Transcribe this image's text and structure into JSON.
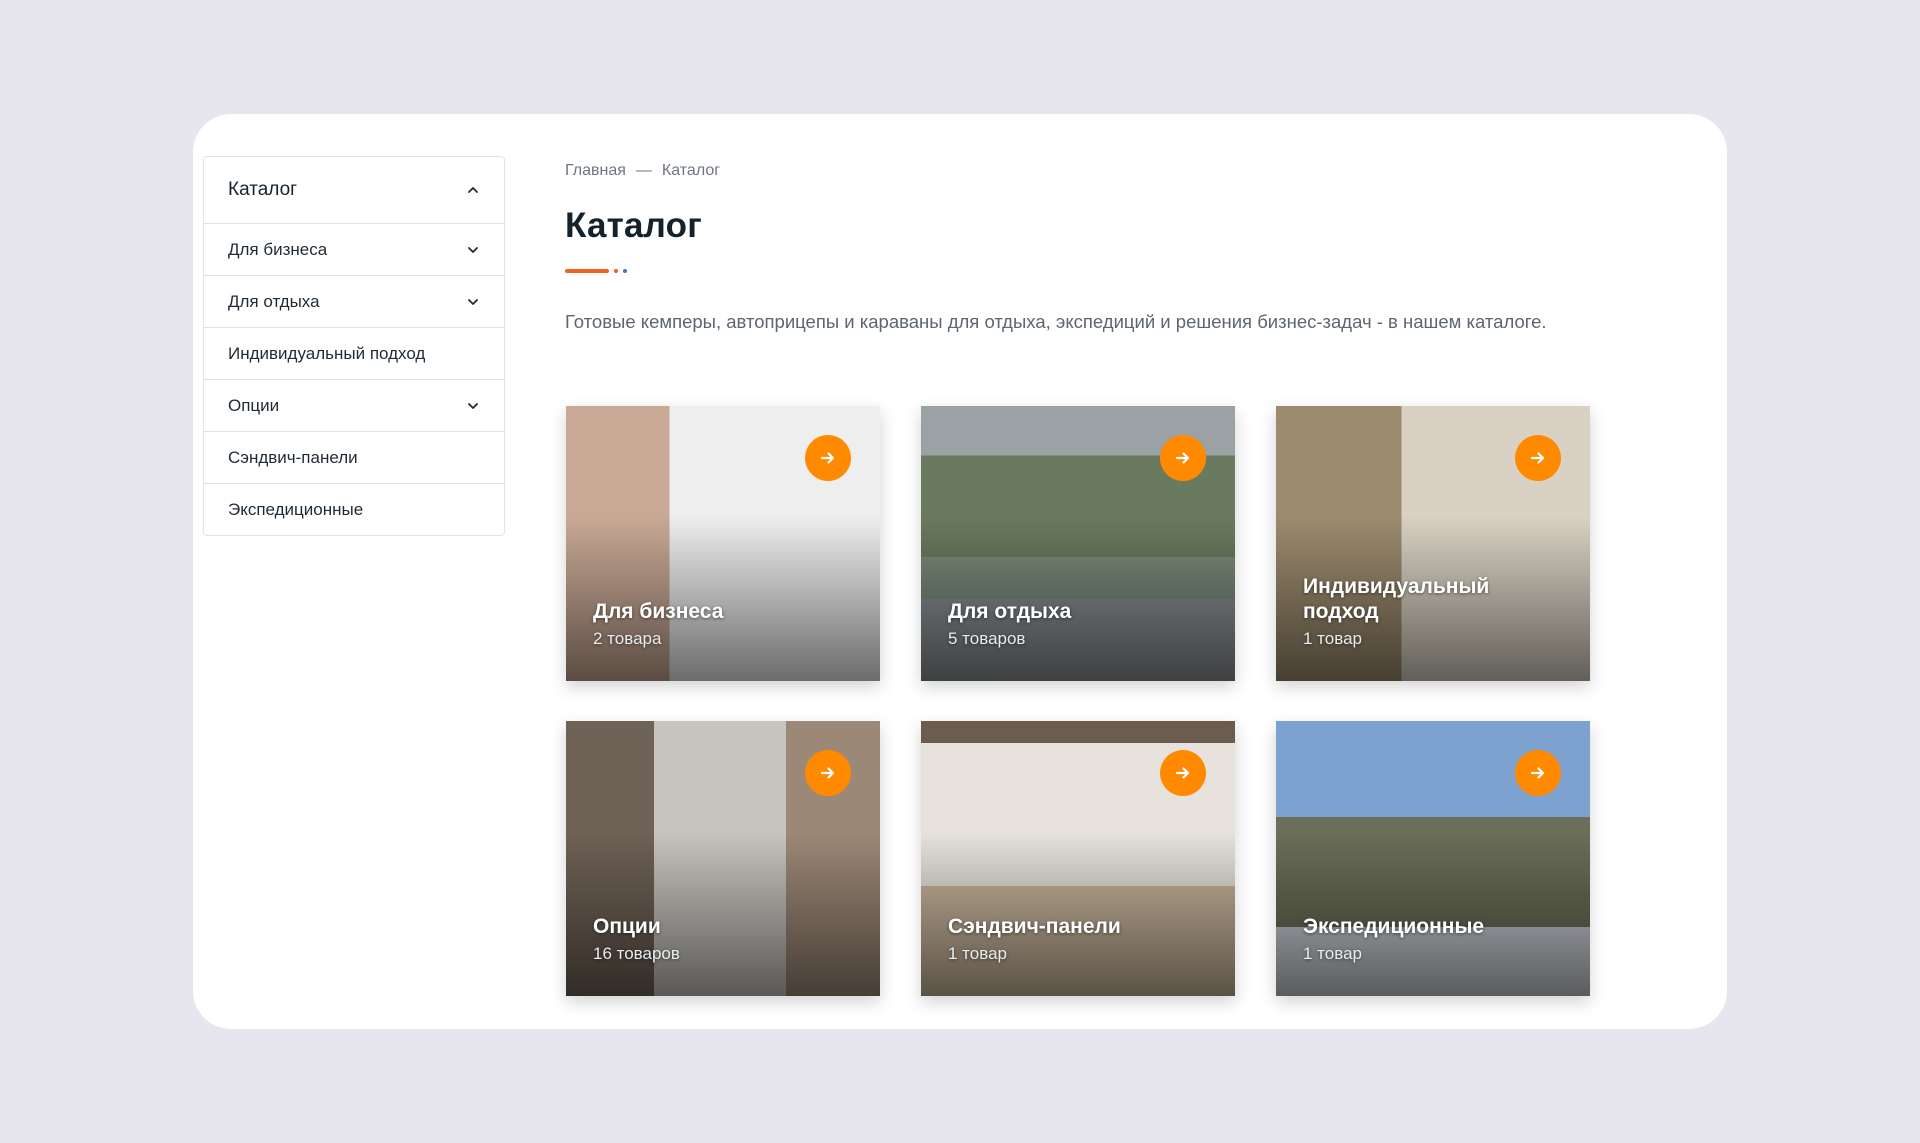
{
  "sidebar": {
    "header": "Каталог",
    "items": [
      {
        "label": "Для бизнеса",
        "has_children": true
      },
      {
        "label": "Для отдыха",
        "has_children": true
      },
      {
        "label": "Индивидуальный подход",
        "has_children": false
      },
      {
        "label": "Опции",
        "has_children": true
      },
      {
        "label": "Сэндвич-панели",
        "has_children": false
      },
      {
        "label": "Экспедиционные",
        "has_children": false
      }
    ]
  },
  "breadcrumb": {
    "home": "Главная",
    "separator": "—",
    "current": "Каталог"
  },
  "page": {
    "title": "Каталог",
    "description": "Готовые кемперы, автоприцепы и караваны для отдыха, экспедиций и решения бизнес-задач - в нашем каталоге."
  },
  "categories": [
    {
      "name": "Для бизнеса",
      "count": "2 товара"
    },
    {
      "name": "Для отдыха",
      "count": "5 товаров"
    },
    {
      "name": "Индивидуальный подход",
      "count": "1 товар"
    },
    {
      "name": "Опции",
      "count": "16 товаров"
    },
    {
      "name": "Сэндвич-панели",
      "count": "1 товар"
    },
    {
      "name": "Экспедиционные",
      "count": "1 товар"
    }
  ],
  "colors": {
    "accent": "#ff8a00",
    "underline": "#f0621f",
    "background": "#e7e6ef"
  },
  "icons": {
    "expand": "chevron-down-icon",
    "collapse": "chevron-up-icon",
    "tile_link": "arrow-right-icon"
  }
}
